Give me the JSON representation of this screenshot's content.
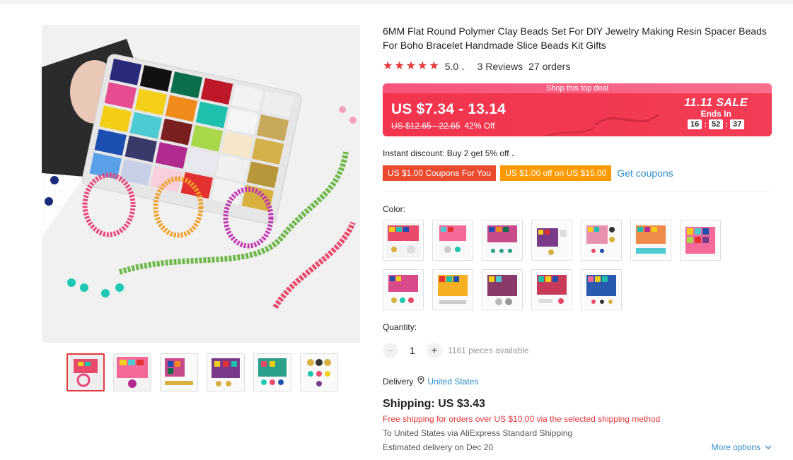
{
  "product": {
    "title": "6MM Flat Round Polymer Clay Beads Set For DIY Jewelry Making Resin Spacer Beads For Boho Bracelet Handmade Slice Beads Kit Gifts",
    "rating": "5.0",
    "reviews": "3 Reviews",
    "orders": "27 orders"
  },
  "deal": {
    "header": "Shop this top deal",
    "price": "US $7.34 - 13.14",
    "original_price": "US $12.65 - 22.65",
    "discount": "42% Off",
    "sale_title": "11.11 SALE",
    "ends_in": "Ends In",
    "timer": {
      "hours": "16",
      "minutes": "52",
      "seconds": "37"
    }
  },
  "discount": {
    "instant": "Instant discount: Buy 2 get 5% off",
    "coupon1": "US $1.00 Coupons For You",
    "coupon2": "US $1.00 off on US $15.00",
    "get_coupons": "Get coupons"
  },
  "color": {
    "label": "Color:",
    "options_count": 12
  },
  "quantity": {
    "label": "Quantity:",
    "minus": "−",
    "value": "1",
    "plus": "+",
    "available": "1161 pieces available"
  },
  "delivery": {
    "label": "Delivery",
    "location": "United States"
  },
  "shipping": {
    "title": "Shipping: US $3.43",
    "free": "Free shipping for orders over US $10.00 via the selected shipping method",
    "via": "To United States via AliExpress Standard Shipping",
    "eta": "Estimated delivery on Dec 20",
    "more": "More options"
  },
  "colors": {
    "accent": "#e4393c",
    "deal_bg": "#f23a4f",
    "link": "#2e8ccb",
    "coupon_red": "#ea4b2f",
    "coupon_orange": "#ff9a00"
  }
}
